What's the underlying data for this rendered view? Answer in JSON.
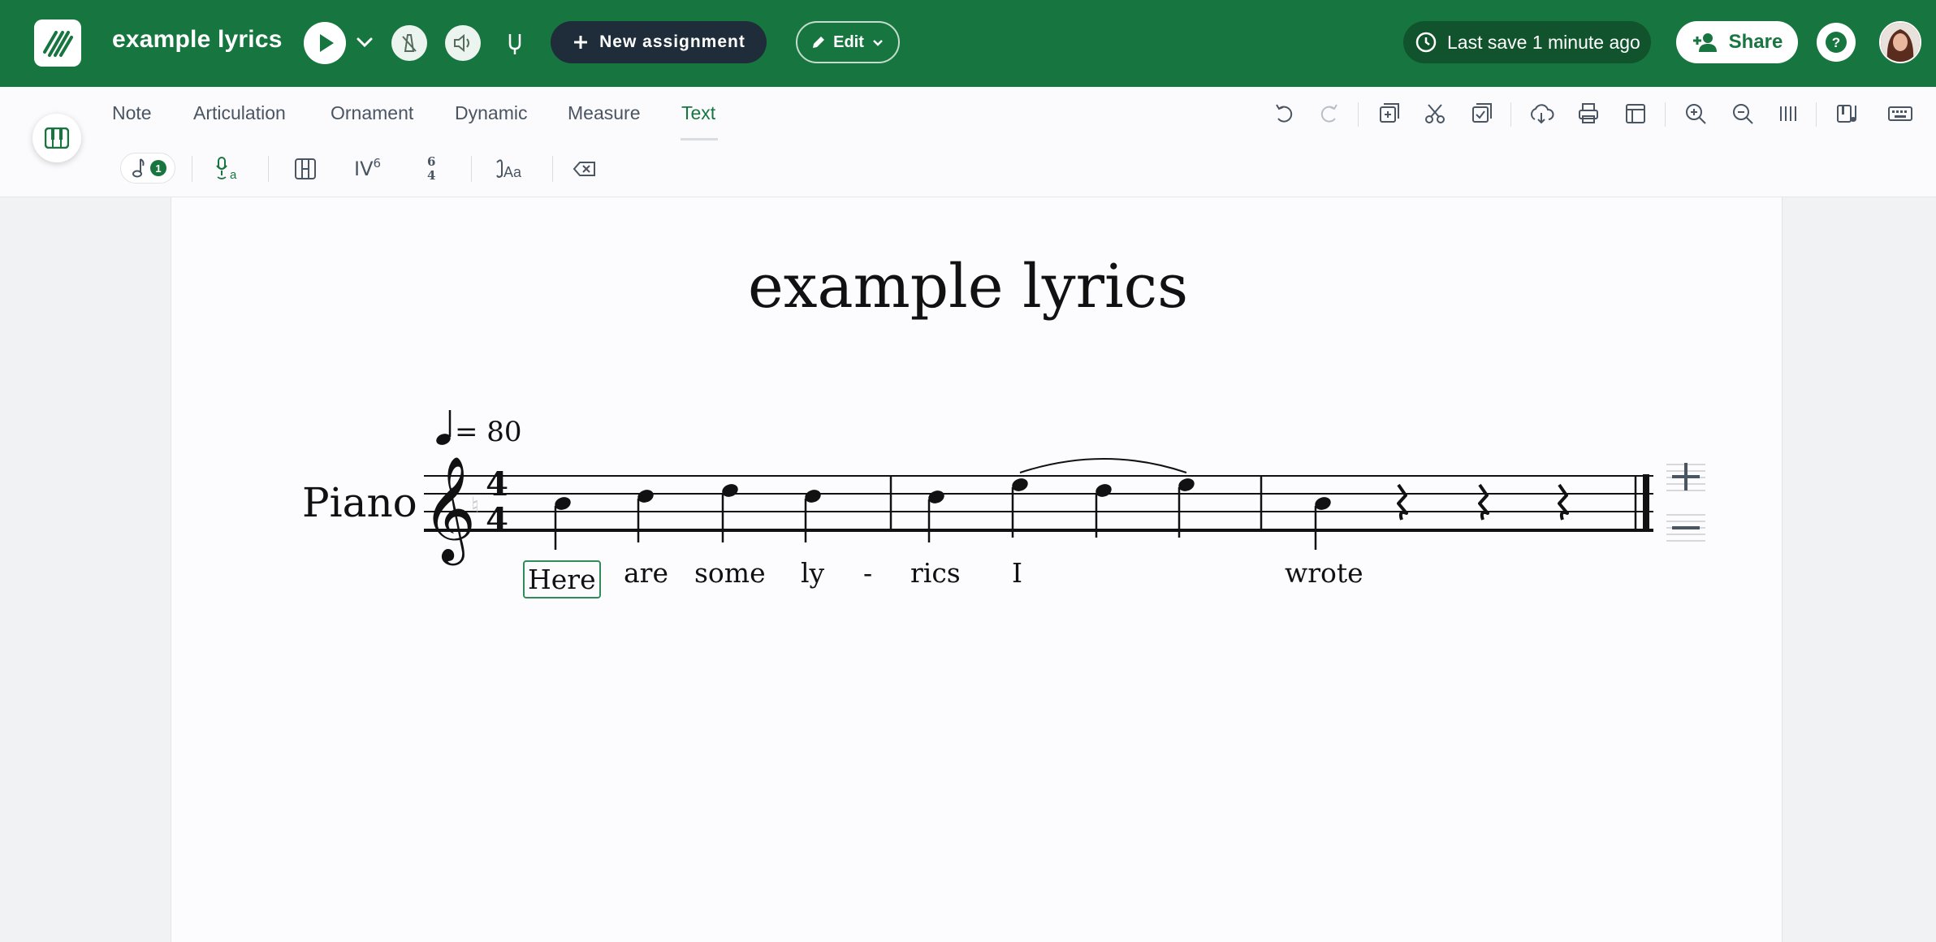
{
  "header": {
    "title": "example lyrics",
    "new_assignment_label": "New assignment",
    "edit_label": "Edit",
    "last_save": "Last save 1 minute ago",
    "share_label": "Share",
    "help_glyph": "?",
    "brand_color": "#17763f"
  },
  "toolbar": {
    "tabs": [
      {
        "label": "Note"
      },
      {
        "label": "Articulation"
      },
      {
        "label": "Ornament"
      },
      {
        "label": "Dynamic"
      },
      {
        "label": "Measure"
      },
      {
        "label": "Text",
        "active": true
      }
    ],
    "right_icons": [
      "undo-icon",
      "redo-icon",
      "add-measure-icon",
      "cut-icon",
      "paste-icon",
      "download-icon",
      "print-icon",
      "layout-icon",
      "zoom-in-icon",
      "zoom-out-icon",
      "columns-icon",
      "instrument-icon",
      "keyboard-icon"
    ],
    "text_tools": {
      "lyrics_verse_badge": "1",
      "roman_numeral_label": "IV",
      "roman_numeral_sup": "6",
      "figured_bass_top": "6",
      "figured_bass_bottom": "4",
      "tool_icons": [
        "lyrics-verse-icon",
        "chord-symbol-icon",
        "rehearsal-mark-icon",
        "roman-numeral-icon",
        "figured-bass-icon",
        "text-style-icon",
        "delete-text-icon"
      ]
    }
  },
  "score": {
    "title": "example lyrics",
    "tempo_value": "= 80",
    "instrument": "Piano",
    "time_signature_top": "4",
    "time_signature_bottom": "4",
    "lyrics": [
      "Here",
      "are",
      "some",
      "ly",
      "-",
      "rics",
      "I",
      "wrote"
    ],
    "selected_lyric_index": 0
  }
}
